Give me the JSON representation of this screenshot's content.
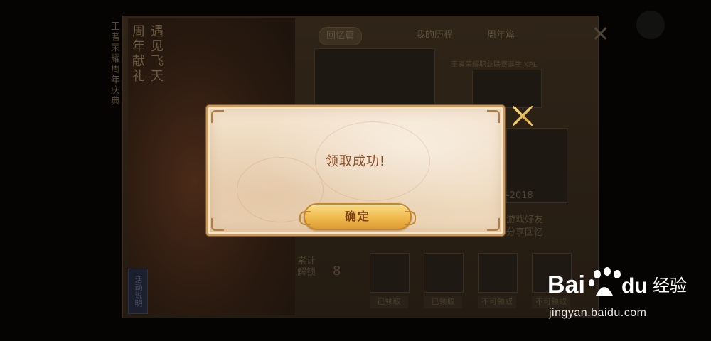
{
  "dialog": {
    "message": "领取成功!",
    "confirm_label": "确定"
  },
  "background": {
    "tabs": [
      "回忆篇",
      "我的历程",
      "周年篇"
    ],
    "vertical_title_1": "遇见飞天",
    "vertical_title_2": "周年献礼",
    "side_banner": "王者荣耀周年庆典",
    "kpl_caption": "王者荣耀职业联赛诞生 KPL",
    "year_range": "-2018",
    "share_caption_1": "游戏好友",
    "share_caption_2": "分享回忆",
    "cumulative_label": "累计\n解锁",
    "cumulative_count": "8",
    "activity_button": "活动说明",
    "rewards": [
      {
        "label": "已领取"
      },
      {
        "label": "已领取"
      },
      {
        "label": "不可领取"
      },
      {
        "label": "不可领取"
      }
    ]
  },
  "watermark": {
    "brand": "Bai du 经验",
    "url": "jingyan.baidu.com"
  },
  "colors": {
    "dialog_bg": "#f0dcc0",
    "dialog_border": "#c99a5c",
    "message_text": "#8a4b26",
    "button_fill": "#efb94d",
    "close_icon": "#e4b24e"
  }
}
